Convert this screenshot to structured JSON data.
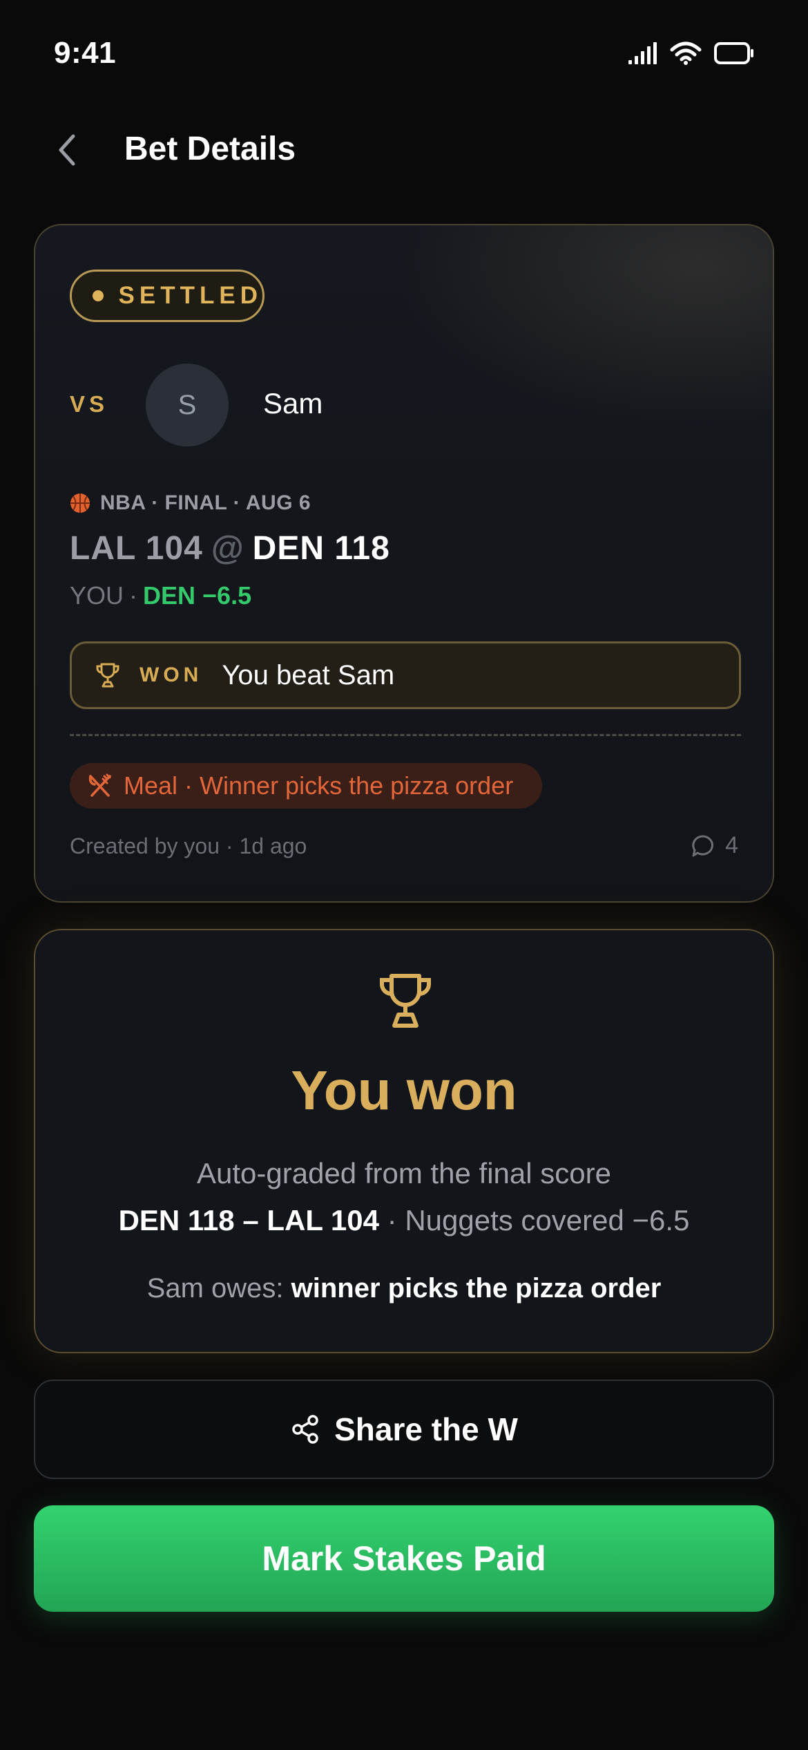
{
  "status_bar": {
    "time": "9:41"
  },
  "header": {
    "title": "Bet Details"
  },
  "bet": {
    "status": "SETTLED",
    "vs_label": "VS",
    "opponent": {
      "initial": "S",
      "name": "Sam"
    },
    "game_meta": "NBA · FINAL · AUG 6",
    "score": {
      "away": "LAL 104",
      "at": "@",
      "home": "DEN 118"
    },
    "pick": {
      "you": "YOU",
      "sep": "·",
      "value": "DEN −6.5"
    },
    "result": {
      "tag": "WON",
      "text": "You beat Sam"
    },
    "stake": "Meal · Winner picks the pizza order",
    "created": "Created by you · 1d ago",
    "comment_count": "4"
  },
  "outcome": {
    "title": "You won",
    "subtitle": "Auto-graded from the final score",
    "score_bold": "DEN 118 – LAL 104",
    "score_rest": " · Nuggets covered −6.5",
    "owes_prefix": "Sam owes: ",
    "owes_value": "winner picks the pizza order"
  },
  "actions": {
    "share_label": "Share the W",
    "paid_label": "Mark Stakes Paid"
  },
  "colors": {
    "accent_gold": "#d9ae5c",
    "win_green": "#34c96a",
    "meal_orange": "#e3663a"
  }
}
